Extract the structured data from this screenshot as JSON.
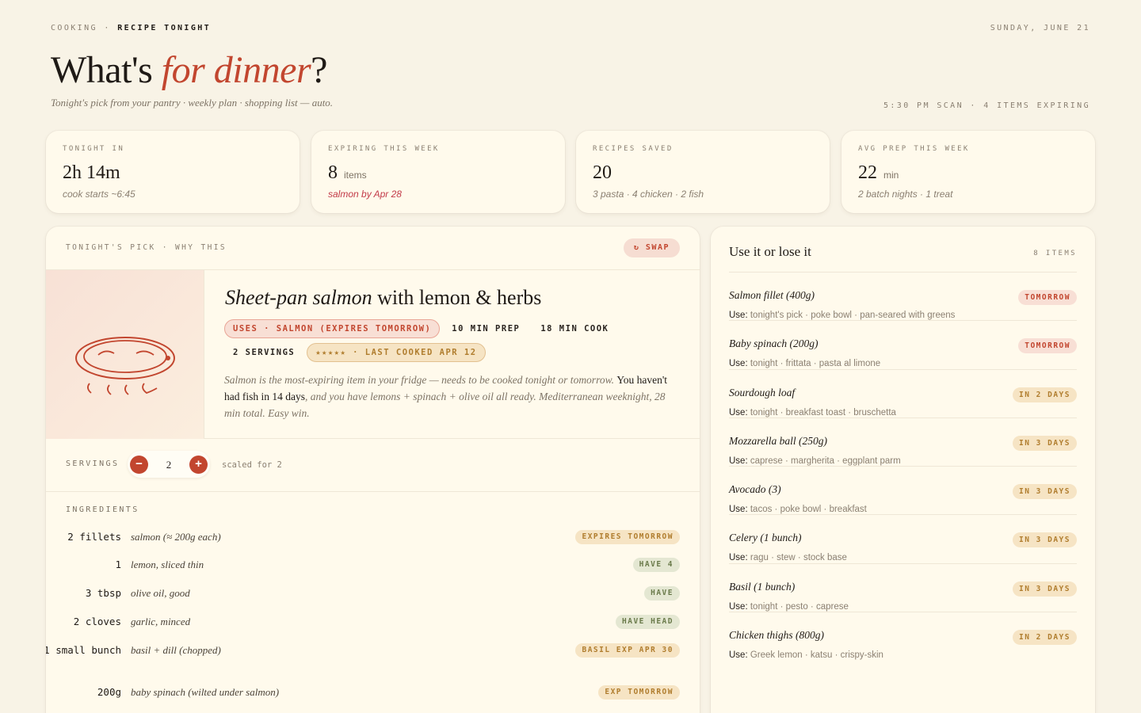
{
  "header": {
    "section": "COOKING",
    "separator": "·",
    "page": "RECIPE TONIGHT",
    "date": "SUNDAY, JUNE 21",
    "title_start": "What's ",
    "title_accent": "for dinner",
    "title_end": "?",
    "subtitle": "Tonight's pick from your pantry · weekly plan · shopping list — auto.",
    "scan_status": "5:30 PM SCAN · 4 ITEMS EXPIRING"
  },
  "stats": [
    {
      "label": "TONIGHT IN",
      "value": "2h 14m",
      "unit": "",
      "sub": "cook starts ~6:45"
    },
    {
      "label": "EXPIRING THIS WEEK",
      "value": "8",
      "unit": "items",
      "sub": "salmon by Apr 28"
    },
    {
      "label": "RECIPES SAVED",
      "value": "20",
      "unit": "",
      "sub": "3 pasta · 4 chicken · 2 fish"
    },
    {
      "label": "AVG PREP THIS WEEK",
      "value": "22",
      "unit": "min",
      "sub": "2 batch nights · 1 treat"
    }
  ],
  "pick": {
    "header": "TONIGHT'S PICK · WHY THIS",
    "swap_icon": "↻",
    "swap_label": "SWAP",
    "title_italic": "Sheet-pan salmon",
    "title_rest": " with lemon & herbs",
    "chips": [
      "USES · SALMON (EXPIRES TOMORROW)",
      "10 MIN PREP",
      "18 MIN COOK",
      "2 SERVINGS",
      "★★★★★ · LAST COOKED APR 12"
    ],
    "desc_1": "Salmon is the most-expiring item in your fridge — needs to be cooked tonight or tomorrow. ",
    "desc_2": "You haven't had fish in 14 days",
    "desc_3": ", and you have lemons + spinach + olive oil all ready. Mediterranean weeknight, 28 min total. Easy win."
  },
  "servings": {
    "label": "SERVINGS",
    "minus": "−",
    "value": "2",
    "plus": "+",
    "scaled": "scaled for 2"
  },
  "ingredients": {
    "label": "INGREDIENTS",
    "items": [
      {
        "qty": "2 fillets",
        "name": "salmon (≈ 200g each)",
        "tag": "EXPIRES TOMORROW",
        "tone": "gold"
      },
      {
        "qty": "1",
        "name": "lemon, sliced thin",
        "tag": "HAVE 4",
        "tone": "green"
      },
      {
        "qty": "3 tbsp",
        "name": "olive oil, good",
        "tag": "HAVE",
        "tone": "green"
      },
      {
        "qty": "2 cloves",
        "name": "garlic, minced",
        "tag": "HAVE HEAD",
        "tone": "green"
      },
      {
        "qty": "1 small bunch",
        "name": "basil + dill (chopped)",
        "tag": "BASIL EXP APR 30",
        "tone": "gold"
      },
      {
        "qty": "200g",
        "name": "baby spinach (wilted under salmon)",
        "tag": "EXP TOMORROW",
        "tone": "gold"
      }
    ]
  },
  "expiring": {
    "title": "Use it or lose it",
    "count": "8 ITEMS",
    "use_prefix": "Use:",
    "items": [
      {
        "name": "Salmon fillet (400g)",
        "use": "tonight's pick · poke bowl · pan-seared with greens",
        "tag": "TOMORROW",
        "tone": "red"
      },
      {
        "name": "Baby spinach (200g)",
        "use": "tonight · frittata · pasta al limone",
        "tag": "TOMORROW",
        "tone": "red"
      },
      {
        "name": "Sourdough loaf",
        "use": "tonight · breakfast toast · bruschetta",
        "tag": "IN 2 DAYS",
        "tone": "gold"
      },
      {
        "name": "Mozzarella ball (250g)",
        "use": "caprese · margherita · eggplant parm",
        "tag": "IN 3 DAYS",
        "tone": "gold"
      },
      {
        "name": "Avocado (3)",
        "use": "tacos · poke bowl · breakfast",
        "tag": "IN 3 DAYS",
        "tone": "gold"
      },
      {
        "name": "Celery (1 bunch)",
        "use": "ragu · stew · stock base",
        "tag": "IN 3 DAYS",
        "tone": "gold"
      },
      {
        "name": "Basil (1 bunch)",
        "use": "tonight · pesto · caprese",
        "tag": "IN 3 DAYS",
        "tone": "gold"
      },
      {
        "name": "Chicken thighs (800g)",
        "use": "Greek lemon · katsu · crispy-skin",
        "tag": "IN 2 DAYS",
        "tone": "gold"
      }
    ]
  },
  "colors": {
    "accent": "#c2462f",
    "background": "#f8f3e6",
    "card": "#fffaec",
    "gold": "#b07d2e",
    "green": "#6a7a4a"
  }
}
